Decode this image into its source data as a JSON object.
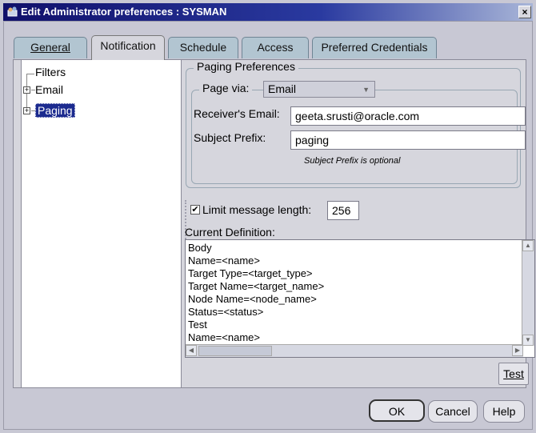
{
  "window": {
    "title": "Edit Administrator preferences : SYSMAN",
    "close_glyph": "×",
    "icon": "app-icon"
  },
  "tabs": [
    {
      "label": "General",
      "active": false
    },
    {
      "label": "Notification",
      "active": true
    },
    {
      "label": "Schedule",
      "active": false
    },
    {
      "label": "Access",
      "active": false
    },
    {
      "label": "Preferred Credentials",
      "active": false
    }
  ],
  "tree": {
    "items": [
      {
        "label": "Filters",
        "expandable": false
      },
      {
        "label": "Email",
        "expandable": true
      },
      {
        "label": "Paging",
        "expandable": true,
        "selected": true
      }
    ],
    "expander_glyph": "+"
  },
  "paging": {
    "group_title": "Paging Preferences",
    "page_via_label": "Page via:",
    "page_via_value": "Email",
    "receiver_label": "Receiver's Email:",
    "receiver_value": "geeta.srusti@oracle.com",
    "subject_label": "Subject Prefix:",
    "subject_value": "paging",
    "subject_hint": "Subject Prefix is optional"
  },
  "limit": {
    "checked": true,
    "check_glyph": "✔",
    "label": "Limit message length:",
    "value": "256"
  },
  "definition": {
    "label": "Current Definition:",
    "lines": [
      "Body",
      " Name=<name>",
      " Target Type=<target_type>",
      " Target Name=<target_name>",
      " Node Name=<node_name>",
      " Status=<status>",
      "Test",
      " Name=<name>"
    ],
    "scroll_up_glyph": "▲",
    "scroll_down_glyph": "▼",
    "scroll_left_glyph": "◀",
    "scroll_right_glyph": "▶"
  },
  "buttons": {
    "test": "Test",
    "ok": "OK",
    "cancel": "Cancel",
    "help": "Help"
  },
  "colors": {
    "titlebar_start": "#10106a",
    "tab_inactive": "#b2c5d1",
    "selection": "#1c2b8f"
  }
}
